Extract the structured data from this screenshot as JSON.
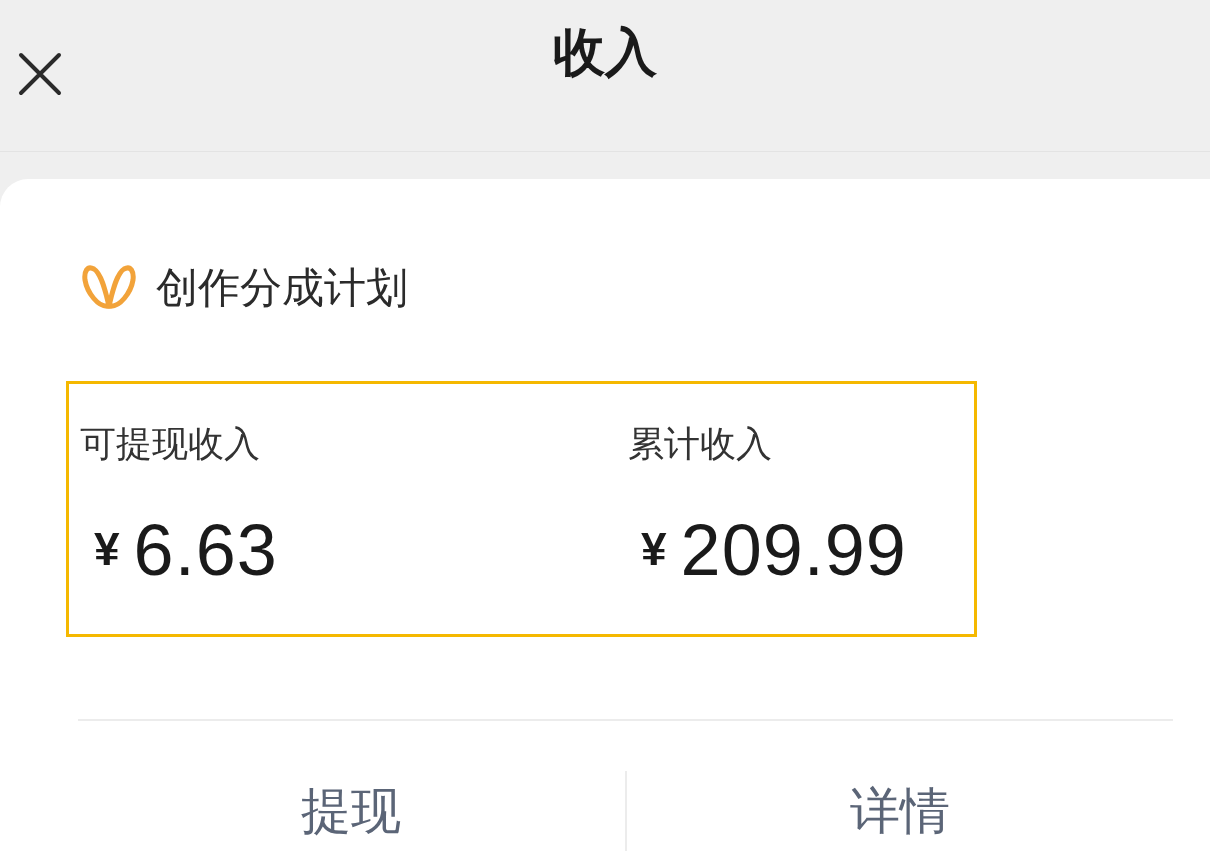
{
  "header": {
    "title": "收入"
  },
  "plan": {
    "name": "创作分成计划"
  },
  "summary": {
    "highlighted": true,
    "items": [
      {
        "label": "可提现收入",
        "currency": "¥",
        "amount": "6.63"
      },
      {
        "label": "累计收入",
        "currency": "¥",
        "amount": "209.99"
      }
    ]
  },
  "actions": [
    "提现",
    "详情"
  ]
}
